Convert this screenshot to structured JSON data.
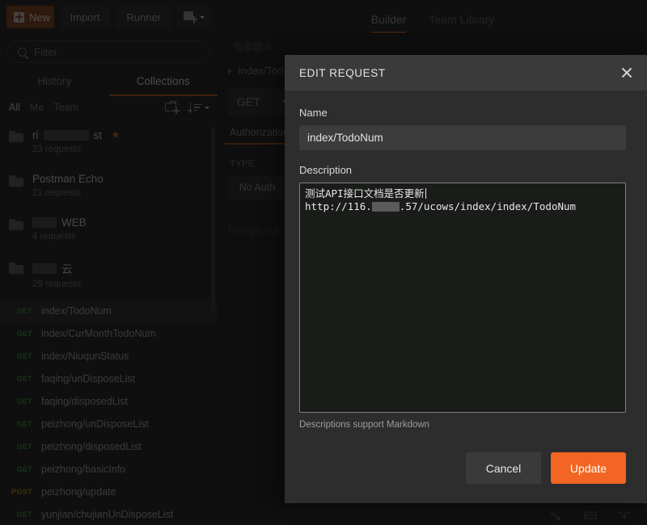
{
  "app": {
    "toolbar": {
      "new_label": "New",
      "new_icon": "plus-square-icon",
      "new_caret_icon": "chevron-down-icon",
      "import_label": "Import",
      "runner_label": "Runner",
      "new_window_icon": "new-window-icon"
    },
    "sidebar": {
      "filter_placeholder": "Filter",
      "search_icon": "search-icon",
      "tabs": [
        {
          "label": "History",
          "active": false
        },
        {
          "label": "Collections",
          "active": true
        }
      ],
      "scope_filters": [
        {
          "label": "All",
          "active": true
        },
        {
          "label": "Me",
          "active": false
        },
        {
          "label": "Team",
          "active": false
        }
      ],
      "new_folder_icon": "new-folder-icon",
      "sort_icon": "sort-descending-icon",
      "folder_icon": "folder-icon",
      "star_icon": "★",
      "collections": [
        {
          "name_prefix": "ri",
          "name_redacted": true,
          "name_suffix": "st",
          "starred": true,
          "requests": "23 requests"
        },
        {
          "name_prefix": "Postman Echo",
          "name_redacted": false,
          "name_suffix": "",
          "starred": false,
          "requests": "21 requests"
        },
        {
          "name_prefix": "",
          "name_redacted": true,
          "name_suffix": "WEB",
          "starred": false,
          "requests": "4 requests"
        },
        {
          "name_prefix": "",
          "name_redacted": true,
          "name_suffix": "云",
          "starred": false,
          "requests": "29 requests"
        }
      ],
      "requests": [
        {
          "method": "GET",
          "name": "index/TodoNum",
          "selected": true
        },
        {
          "method": "GET",
          "name": "index/CurMonthTodoNum",
          "selected": false
        },
        {
          "method": "GET",
          "name": "index/NiuqunStatus",
          "selected": false
        },
        {
          "method": "GET",
          "name": "faqing/unDisposeList",
          "selected": false
        },
        {
          "method": "GET",
          "name": "faqing/disposedList",
          "selected": false
        },
        {
          "method": "GET",
          "name": "peizhong/unDisposeList",
          "selected": false
        },
        {
          "method": "GET",
          "name": "peizhong/disposedList",
          "selected": false
        },
        {
          "method": "GET",
          "name": "peizhong/basicInfo",
          "selected": false
        },
        {
          "method": "POST",
          "name": "peizhong/update",
          "selected": false
        },
        {
          "method": "GET",
          "name": "yunjian/chujianUnDisposeList",
          "selected": false
        }
      ]
    },
    "main": {
      "workspace_tabs": [
        {
          "label": "Builder",
          "active": true
        },
        {
          "label": "Team Library",
          "active": false
        }
      ],
      "open_tab": "有道翻译",
      "breadcrumb": "Index/Tod",
      "breadcrumb_caret_icon": "chevron-right-icon",
      "method": "GET",
      "method_caret_icon": "chevron-down-icon",
      "request_tabs": [
        {
          "label": "Authorization",
          "active": true
        }
      ],
      "type_label": "TYPE",
      "auth_type": "No Auth",
      "response_label": "Response"
    }
  },
  "modal": {
    "title": "EDIT REQUEST",
    "close_icon": "close-icon",
    "name_label": "Name",
    "name_value": "index/TodoNum",
    "description_label": "Description",
    "description_line1": "测试API接口文档是否更新",
    "description_line2_prefix": "http://116.",
    "description_line2_suffix": ".57/ucows/index/index/TodoNum",
    "description_redacted": true,
    "markdown_hint": "Descriptions support Markdown",
    "cancel_label": "Cancel",
    "update_label": "Update",
    "accent_color": "#f26522"
  }
}
